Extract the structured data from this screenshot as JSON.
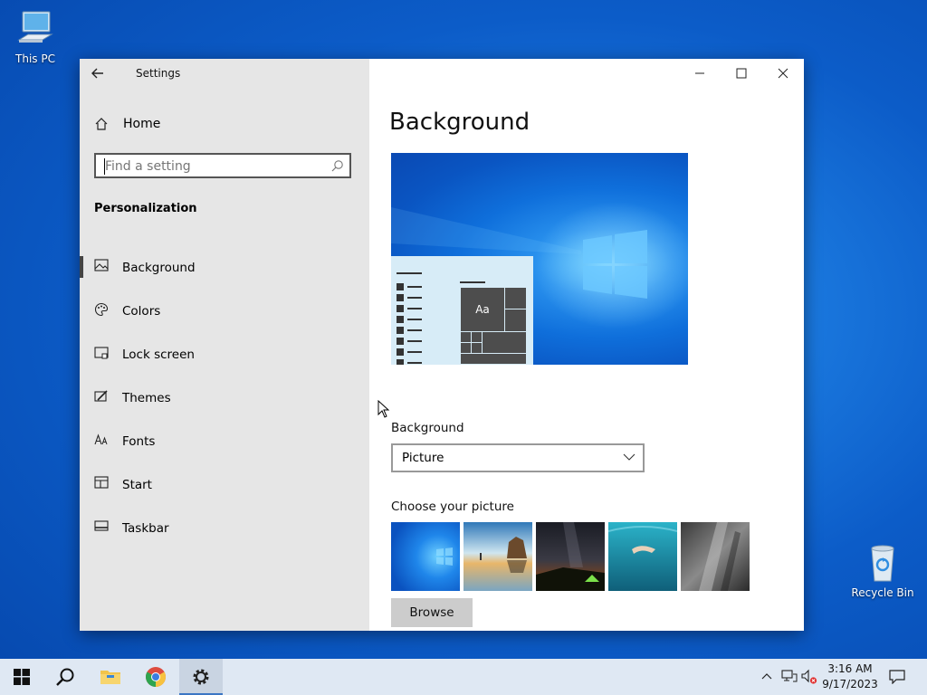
{
  "desktop": {
    "icons": [
      {
        "label": "This PC"
      },
      {
        "label": "Recycle Bin"
      }
    ]
  },
  "window": {
    "app_title": "Settings",
    "sidebar": {
      "home_label": "Home",
      "search_placeholder": "Find a setting",
      "section_title": "Personalization",
      "items": [
        {
          "label": "Background",
          "icon": "picture-icon",
          "selected": true
        },
        {
          "label": "Colors",
          "icon": "palette-icon",
          "selected": false
        },
        {
          "label": "Lock screen",
          "icon": "lock-screen-icon",
          "selected": false
        },
        {
          "label": "Themes",
          "icon": "brush-icon",
          "selected": false
        },
        {
          "label": "Fonts",
          "icon": "fonts-icon",
          "selected": false
        },
        {
          "label": "Start",
          "icon": "start-icon",
          "selected": false
        },
        {
          "label": "Taskbar",
          "icon": "taskbar-icon",
          "selected": false
        }
      ]
    },
    "content": {
      "page_title": "Background",
      "preview": {
        "tile_text": "Aa"
      },
      "background_label": "Background",
      "background_value": "Picture",
      "choose_label": "Choose your picture",
      "browse_label": "Browse"
    }
  },
  "taskbar": {
    "apps": [
      {
        "name": "start-button"
      },
      {
        "name": "search-button"
      },
      {
        "name": "file-explorer"
      },
      {
        "name": "chrome"
      },
      {
        "name": "settings",
        "active": true
      }
    ],
    "clock": {
      "time": "3:16 AM",
      "date": "9/17/2023"
    }
  },
  "colors": {
    "accent": "#0078d7",
    "sidebar_bg": "#e6e6e6",
    "taskbar_bg": "#dfe8f3"
  }
}
